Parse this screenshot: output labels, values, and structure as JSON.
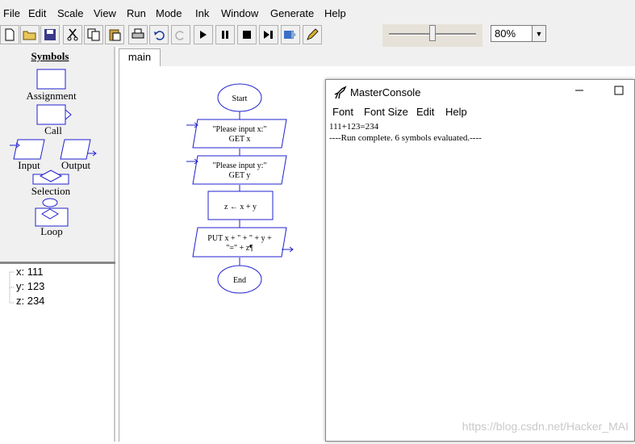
{
  "menubar": {
    "items": [
      "File",
      "Edit",
      "Scale",
      "View",
      "Run",
      "Mode",
      "Ink",
      "Window",
      "Generate",
      "Help"
    ]
  },
  "toolbar": {
    "buttons": [
      "new-icon",
      "open-icon",
      "save-icon",
      "cut-icon",
      "copy-icon",
      "paste-icon",
      "print-icon",
      "undo-icon",
      "redo-icon",
      "run-icon",
      "pause-icon",
      "stop-icon",
      "step-icon",
      "test-server-icon",
      "ink-pen-icon"
    ],
    "zoom": {
      "value": "80%"
    },
    "speed_slider": {
      "level": 0.5
    }
  },
  "symbols": {
    "title": "Symbols",
    "assignment": "Assignment",
    "call": "Call",
    "input": "Input",
    "output": "Output",
    "selection": "Selection",
    "loop": "Loop"
  },
  "variables": [
    {
      "text": "x: 111"
    },
    {
      "text": "y: 123"
    },
    {
      "text": "z: 234"
    }
  ],
  "tabs": [
    {
      "label": "main"
    }
  ],
  "flowchart": {
    "start": "Start",
    "input1_line1": "\"Please input x:\"",
    "input1_line2": "GET x",
    "input2_line1": "\"Please input y:\"",
    "input2_line2": "GET y",
    "assign": "z ← x + y",
    "output_line1": "PUT x + \" + \" + y +",
    "output_line2": "\"=\" + z¶",
    "end": "End"
  },
  "console": {
    "title": "MasterConsole",
    "menu": [
      "Font",
      "Font Size",
      "Edit",
      "Help"
    ],
    "output": [
      "111+123=234",
      "----Run complete.  6 symbols evaluated.----"
    ]
  },
  "watermark": "https://blog.csdn.net/Hacker_MAI",
  "colors": {
    "flow_stroke": "#2020d0",
    "panel_bg": "#f0f0f0"
  }
}
